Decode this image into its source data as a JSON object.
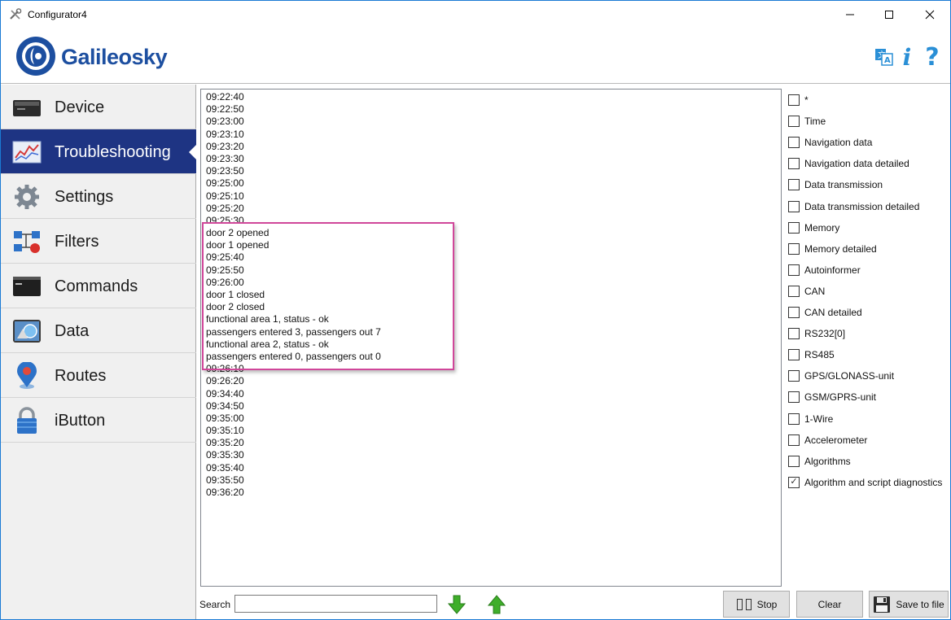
{
  "window": {
    "title": "Configurator4"
  },
  "brand": {
    "name": "Galileosky"
  },
  "header_icons": {
    "info_glyph": "i",
    "help_glyph": "?"
  },
  "sidebar": {
    "active": "Troubleshooting",
    "items": [
      {
        "label": "Device",
        "icon": "device-icon"
      },
      {
        "label": "Troubleshooting",
        "icon": "troubleshooting-chart-icon"
      },
      {
        "label": "Settings",
        "icon": "gear-icon"
      },
      {
        "label": "Filters",
        "icon": "filters-icon"
      },
      {
        "label": "Commands",
        "icon": "terminal-icon"
      },
      {
        "label": "Data",
        "icon": "data-icon"
      },
      {
        "label": "Routes",
        "icon": "map-pin-icon"
      },
      {
        "label": "iButton",
        "icon": "lock-icon"
      }
    ]
  },
  "log": {
    "lines": [
      "09:22:40",
      "09:22:50",
      "09:23:00",
      "09:23:10",
      "09:23:20",
      "09:23:30",
      "09:23:50",
      "09:25:00",
      "09:25:10",
      "09:25:20",
      "09:25:30",
      "door 2 opened",
      "door 1 opened",
      "09:25:40",
      "09:25:50",
      "09:26:00",
      "door 1 closed",
      "door 2 closed",
      "functional area 1, status - ok",
      "passengers entered 3, passengers out 7",
      "functional area 2, status - ok",
      "passengers entered 0, passengers out 0",
      "09:26:10",
      "09:26:20",
      "09:34:40",
      "09:34:50",
      "09:35:00",
      "09:35:10",
      "09:35:20",
      "09:35:30",
      "09:35:40",
      "09:35:50",
      "09:36:20"
    ]
  },
  "filters": [
    {
      "label": "*",
      "checked": false
    },
    {
      "label": "Time",
      "checked": false
    },
    {
      "label": "Navigation data",
      "checked": false
    },
    {
      "label": "Navigation data detailed",
      "checked": false
    },
    {
      "label": "Data transmission",
      "checked": false
    },
    {
      "label": "Data transmission detailed",
      "checked": false
    },
    {
      "label": "Memory",
      "checked": false
    },
    {
      "label": "Memory detailed",
      "checked": false
    },
    {
      "label": "Autoinformer",
      "checked": false
    },
    {
      "label": "CAN",
      "checked": false
    },
    {
      "label": "CAN detailed",
      "checked": false
    },
    {
      "label": "RS232[0]",
      "checked": false
    },
    {
      "label": "RS485",
      "checked": false
    },
    {
      "label": "GPS/GLONASS-unit",
      "checked": false
    },
    {
      "label": "GSM/GPRS-unit",
      "checked": false
    },
    {
      "label": "1-Wire",
      "checked": false
    },
    {
      "label": "Accelerometer",
      "checked": false
    },
    {
      "label": "Algorithms",
      "checked": false
    },
    {
      "label": "Algorithm and script diagnostics",
      "checked": true
    }
  ],
  "search": {
    "label": "Search",
    "value": ""
  },
  "buttons": {
    "stop": "Stop",
    "clear": "Clear",
    "save": "Save to file"
  },
  "colors": {
    "active_nav": "#1e3483",
    "brand_blue": "#1d4fa0",
    "highlight": "#d0479a",
    "arrow_green": "#3fae2a"
  }
}
